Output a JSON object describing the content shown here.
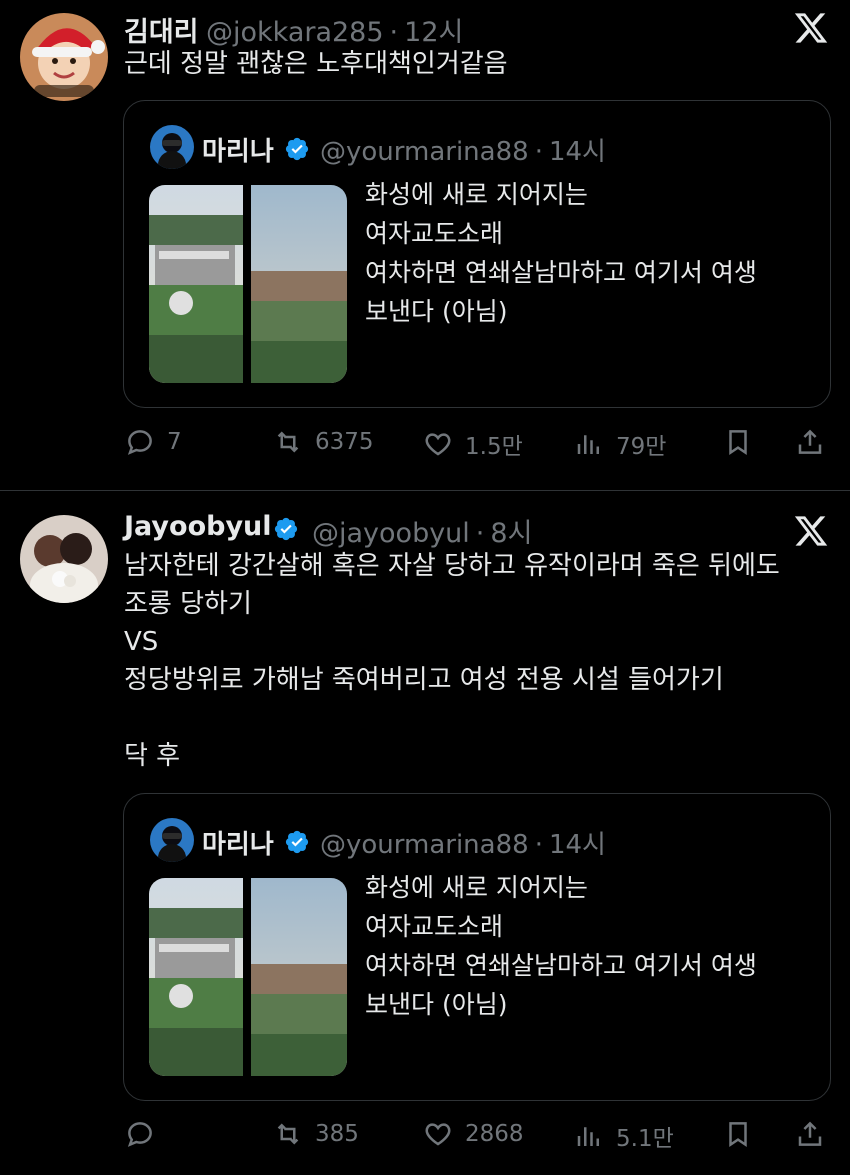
{
  "tweets": [
    {
      "author": "김대리",
      "handle": "@jokkara285",
      "time": "12시",
      "lines": [
        "근데 정말 괜찮은 노후대책인거같음"
      ],
      "quote": {
        "author": "마리나",
        "handle": "@yourmarina88",
        "time": "14시",
        "lines": [
          "화성에 새로 지어지는",
          "여자교도소래",
          "여차하면 연쇄살남마하고 여기서 여생",
          "보낸다 (아님)"
        ]
      },
      "actions": {
        "reply": "7",
        "retweet": "6375",
        "like": "1.5만",
        "views": "79만"
      }
    },
    {
      "author": "Jayoobyul",
      "handle": "@jayoobyul",
      "time": "8시",
      "lines": [
        "남자한테 강간살해 혹은 자살 당하고 유작이라며 죽은 뒤에도",
        "조롱 당하기",
        "VS",
        "정당방위로 가해남 죽여버리고 여성 전용 시설 들어가기",
        "",
        "닥 후"
      ],
      "quote": {
        "author": "마리나",
        "handle": "@yourmarina88",
        "time": "14시",
        "lines": [
          "화성에 새로 지어지는",
          "여자교도소래",
          "여차하면 연쇄살남마하고 여기서 여생",
          "보낸다 (아님)"
        ]
      },
      "actions": {
        "reply": "",
        "retweet": "385",
        "like": "2868",
        "views": "5.1만"
      }
    }
  ],
  "separator_dot": "·",
  "colors": {
    "background": "#000000",
    "text": "#e7e9ea",
    "muted": "#71767b",
    "verified": "#1d9bf0",
    "border": "#2f3336"
  }
}
